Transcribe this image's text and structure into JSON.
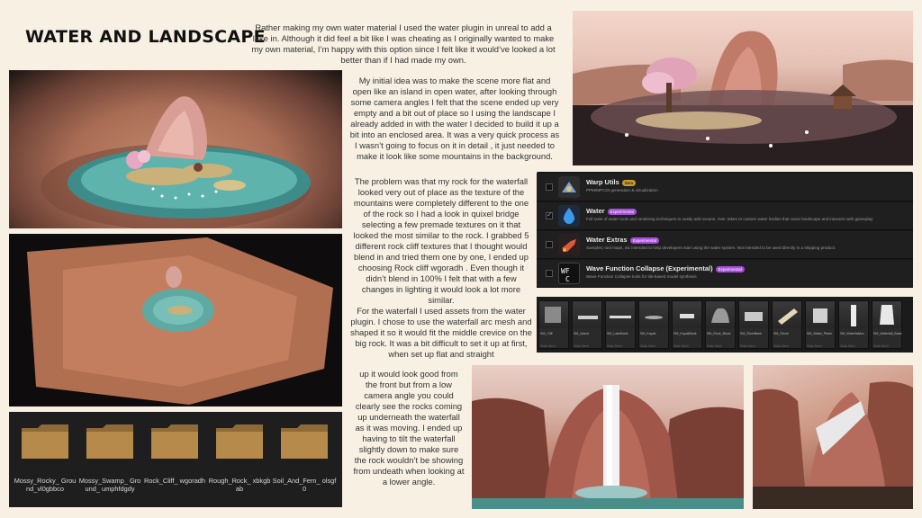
{
  "title": "WATER AND LANDSCAPE",
  "paragraphs": {
    "p1": "Rather making my own water material I used the water plugin in unreal to add a lake in. Although it did feel a bit like I was cheating as I originally wanted to make my own material, I’m happy with this option since I felt like it would’ve looked a lot better than if I had made my own.",
    "p2": "My initial idea was to make the scene more flat and open like an island in open water, after looking through some camera angles I felt that the scene ended up very empty and a bit out of place so I using the landscape I already added in with the water I decided to build it up a bit into an enclosed area. It was a very quick process as I wasn’t going to focus on it in detail , it just needed to make it look like some mountains in the background.",
    "p3": "The problem was that my rock for the waterfall looked very out of place as the texture of the mountains were completely different to the one of the rock so I had a look in quixel bridge selecting a few premade textures on it that looked the most similar to the rock. I grabbed 5 different rock cliff textures that I thought would blend in and tried them one by one, I ended up choosing Rock cliff wgoradh . Even though it didn’t blend in 100% I felt that with a few changes in lighting it would look a lot more similar.",
    "p4": "For the waterfall I used assets from the water plugin. I chose to use the waterfall arc mesh and shaped it so it would fit the middle crevice on the big rock. It was a bit difficult to set it up at first, when set up flat and straight",
    "p5": "up it would look good from the front but from a low camera angle you could clearly see the rocks coming up underneath the waterfall as it was moving. I ended up having to tilt the waterfall slightly down to make sure the rock wouldn’t be showing from undeath when looking at a lower angle."
  },
  "plugins": [
    {
      "name": "Warp Utils",
      "badge": "Beta",
      "desc": "PPM/MPCDI generation & visualization",
      "checked": false
    },
    {
      "name": "Water",
      "badge": "Experimental",
      "desc": "Full suite of water tools and rendering techniques to easily add oceans, river, lakes or custom water bodies that carve landscape and interacts with gameplay",
      "checked": true
    },
    {
      "name": "Water Extras",
      "badge": "Experimental",
      "desc": "Samples, tool maps, etc intended to help developers start using the water system. Not intended to be used directly in a shipping product.",
      "checked": false
    },
    {
      "name": "Wave Function Collapse (Experimental)",
      "badge": "Experimental",
      "desc": "Wave Function Collapse tools for tile-based model synthesis",
      "checked": false
    }
  ],
  "assets": [
    {
      "name": "SM_Cliff",
      "type": "Static Mesh"
    },
    {
      "name": "SM_Island",
      "type": "Static Mesh"
    },
    {
      "name": "SM_LakeBank",
      "type": "Static Mesh"
    },
    {
      "name": "SM_Kayak",
      "type": "Static Mesh"
    },
    {
      "name": "SM_KayakBank",
      "type": "Static Mesh"
    },
    {
      "name": "SM_Rock_Block",
      "type": "Static Mesh"
    },
    {
      "name": "SM_RiverBank",
      "type": "Static Mesh"
    },
    {
      "name": "SM_Shore",
      "type": "Static Mesh"
    },
    {
      "name": "SM_Water_Plane",
      "type": "Static Mesh"
    },
    {
      "name": "SM_WaterfallArc",
      "type": "Static Mesh"
    },
    {
      "name": "SM_Waterfall_Base",
      "type": "Static Mesh"
    }
  ],
  "folders": [
    {
      "label": "Mossy_Rocky_ Ground_vl0gbbco"
    },
    {
      "label": "Mossy_Swamp_ Ground_ umphfdgdy"
    },
    {
      "label": "Rock_Cliff_ wgoradh"
    },
    {
      "label": "Rough_Rock_ xbkgbab"
    },
    {
      "label": "Soil_And_Fern_ olsgf0"
    }
  ],
  "colors": {
    "background": "#f7f0e3",
    "badge_experimental": "#a64ed8",
    "badge_beta": "#c99a2c",
    "folder": "#b58a4a"
  }
}
